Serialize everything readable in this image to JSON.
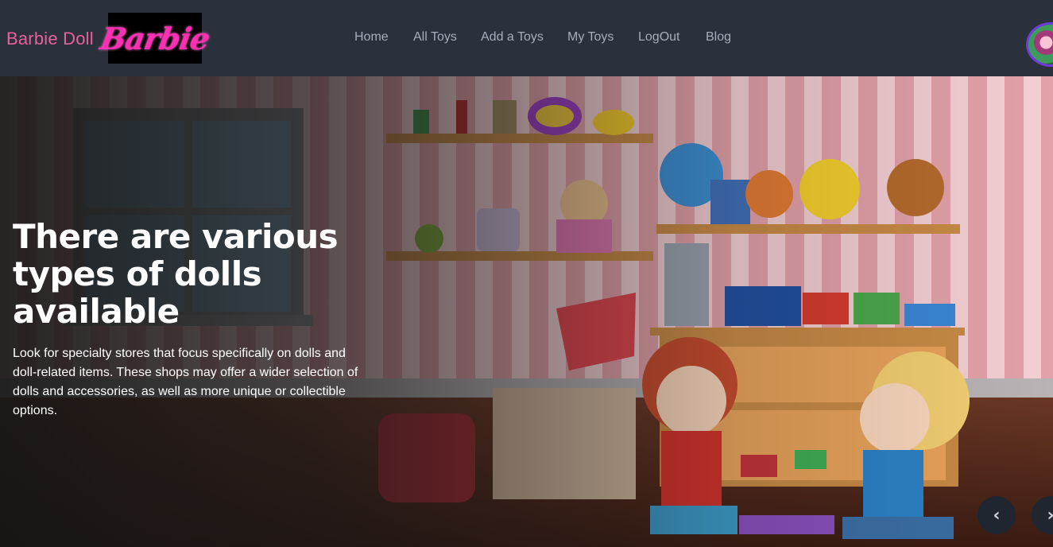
{
  "navbar": {
    "brand": "Barbie Doll",
    "logo_text": "Barbie",
    "links": [
      "Home",
      "All Toys",
      "Add a Toys",
      "My Toys",
      "LogOut",
      "Blog"
    ]
  },
  "hero": {
    "title_lines": [
      "There are various",
      "types of dolls",
      "available"
    ],
    "description": "Look for specialty stores that focus specifically on dolls and doll-related items. These shops may offer a wider selection of dolls and accessories, as well as more unique or collectible options.",
    "prev_icon": "chevron-left-icon",
    "prev_glyph": "‹",
    "next_icon": "chevron-right-icon",
    "next_glyph": "›"
  },
  "colors": {
    "navbar_bg": "#2a303c",
    "brand": "#e8609c",
    "logo_pink": "#ff2fb3",
    "nav_link": "#a6adbb",
    "wall_pink": "#e8a2aa",
    "floor": "#5a2d1e",
    "shelf": "#c98a45"
  }
}
